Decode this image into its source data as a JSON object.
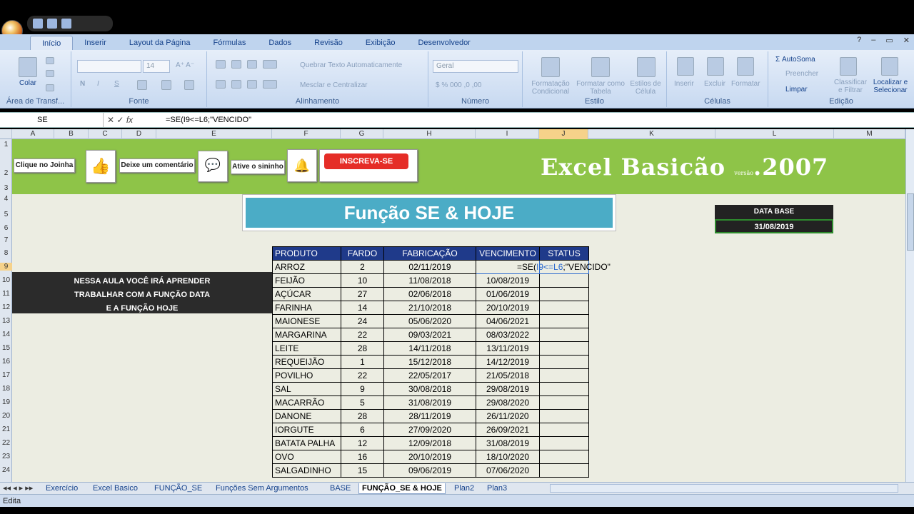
{
  "ribbon": {
    "tabs": [
      "Início",
      "Inserir",
      "Layout da Página",
      "Fórmulas",
      "Dados",
      "Revisão",
      "Exibição",
      "Desenvolvedor"
    ],
    "active_tab": "Início",
    "clipboard": {
      "paste_label": "Colar",
      "group_label": "Área de Transf..."
    },
    "font": {
      "size": "14",
      "group_label": "Fonte"
    },
    "alignment": {
      "wrap_label": "Quebrar Texto Automaticamente",
      "merge_label": "Mesclar e Centralizar",
      "group_label": "Alinhamento"
    },
    "number": {
      "format": "Geral",
      "group_label": "Número"
    },
    "styles": {
      "conditional": "Formatação Condicional",
      "as_table": "Formatar como Tabela",
      "cell_styles": "Estilos de Célula",
      "group_label": "Estilo"
    },
    "cells": {
      "insert": "Inserir",
      "delete": "Excluir",
      "format": "Formatar",
      "group_label": "Células"
    },
    "editing": {
      "autosum": "AutoSoma",
      "fill": "Preencher",
      "clear": "Limpar",
      "sort": "Classificar e Filtrar",
      "find": "Localizar e Selecionar",
      "group_label": "Edição"
    }
  },
  "formula_bar": {
    "name_box": "SE",
    "fx": "fx",
    "formula": "=SE(I9<=L6;\"VENCIDO\""
  },
  "columns": [
    "A",
    "B",
    "C",
    "D",
    "E",
    "F",
    "G",
    "H",
    "I",
    "J",
    "K",
    "L",
    "M"
  ],
  "rows": [
    "1",
    "2",
    "3",
    "4",
    "5",
    "6",
    "7",
    "8",
    "9",
    "10",
    "11",
    "12",
    "13",
    "14",
    "15",
    "16",
    "17",
    "18",
    "19",
    "20",
    "21",
    "22",
    "23",
    "24"
  ],
  "banner": {
    "like_label": "Clique no Joinha",
    "comment_label": "Deixe um comentário",
    "bell_label": "Ative o sininho",
    "subscribe_label": "INSCREVA-SE",
    "title_main": "Excel Basicão",
    "title_version_word": "versão",
    "title_year": ".2007"
  },
  "heading": "Função SE & HOJE",
  "data_base": {
    "label": "DATA BASE",
    "value": "31/08/2019"
  },
  "lesson": {
    "line1": "NESSA AULA VOCÊ IRÁ APRENDER",
    "line2": "TRABALHAR COM A FUNÇÃO DATA",
    "line3": "E A FUNÇÃO HOJE"
  },
  "table": {
    "headers": [
      "PRODUTO",
      "FARDO",
      "FABRICAÇÃO",
      "VENCIMENTO",
      "STATUS"
    ],
    "rows": [
      [
        "ARROZ",
        "2",
        "02/11/2019",
        "",
        ""
      ],
      [
        "FEIJÃO",
        "10",
        "11/08/2018",
        "10/08/2019",
        ""
      ],
      [
        "AÇÚCAR",
        "27",
        "02/06/2018",
        "01/06/2019",
        ""
      ],
      [
        "FARINHA",
        "14",
        "21/10/2018",
        "20/10/2019",
        ""
      ],
      [
        "MAIONESE",
        "24",
        "05/06/2020",
        "04/06/2021",
        ""
      ],
      [
        "MARGARINA",
        "22",
        "09/03/2021",
        "08/03/2022",
        ""
      ],
      [
        "LEITE",
        "28",
        "14/11/2018",
        "13/11/2019",
        ""
      ],
      [
        "REQUEIJÃO",
        "1",
        "15/12/2018",
        "14/12/2019",
        ""
      ],
      [
        "POVILHO",
        "22",
        "22/05/2017",
        "21/05/2018",
        ""
      ],
      [
        "SAL",
        "9",
        "30/08/2018",
        "29/08/2019",
        ""
      ],
      [
        "MACARRÃO",
        "5",
        "31/08/2019",
        "29/08/2020",
        ""
      ],
      [
        "DANONE",
        "28",
        "28/11/2019",
        "26/11/2020",
        ""
      ],
      [
        "IORGUTE",
        "6",
        "27/09/2020",
        "26/09/2021",
        ""
      ],
      [
        "BATATA PALHA",
        "12",
        "12/09/2018",
        "31/08/2019",
        ""
      ],
      [
        "OVO",
        "16",
        "20/10/2019",
        "18/10/2020",
        ""
      ],
      [
        "SALGADINHO",
        "15",
        "09/06/2019",
        "07/06/2020",
        ""
      ]
    ],
    "editing_text_a": "=SE(",
    "editing_text_b": "I9<=L6",
    "editing_text_c": ";\"VENCIDO\""
  },
  "sheet_tabs": [
    "Exercício",
    "Excel Basico",
    "FUNÇÃO_SE",
    "Funções Sem Argumentos",
    "BASE",
    "FUNÇÃO_SE & HOJE",
    "Plan2",
    "Plan3"
  ],
  "active_sheet": "FUNÇÃO_SE & HOJE",
  "status": {
    "mode": "Edita"
  }
}
